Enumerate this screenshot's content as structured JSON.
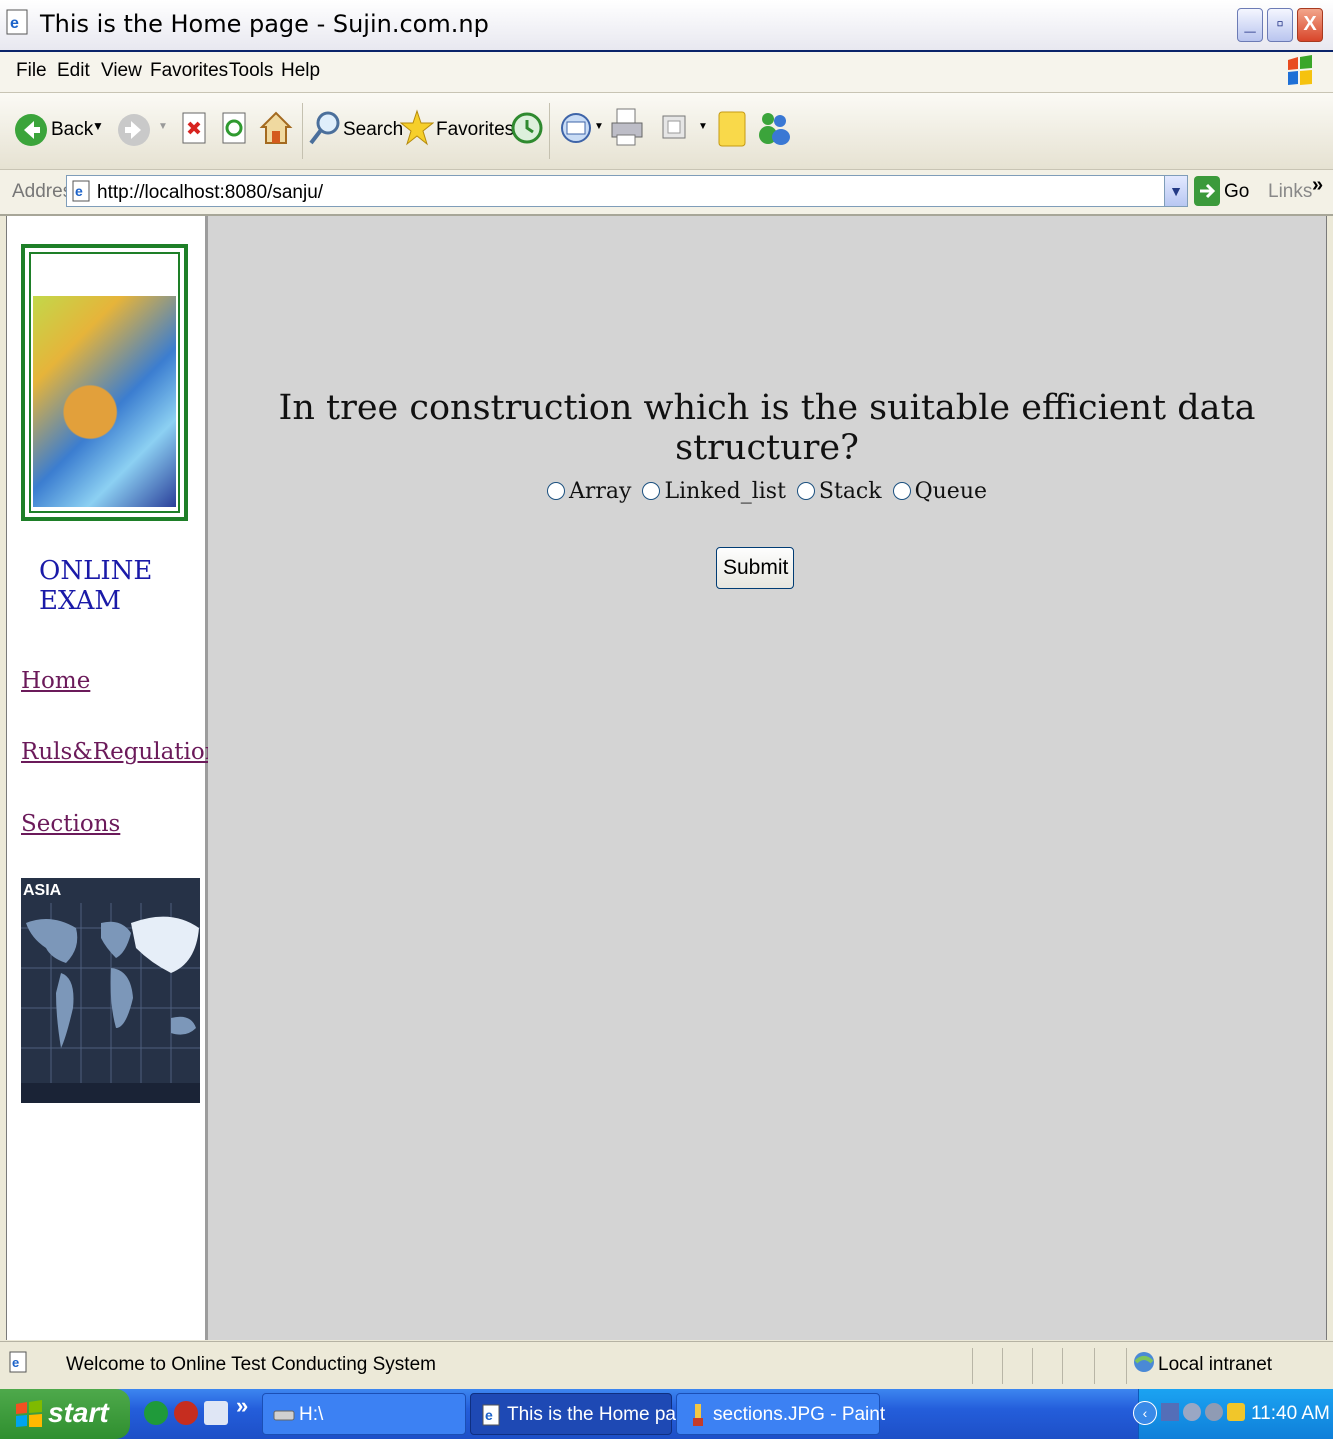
{
  "window": {
    "title": "This is the Home page - Sujin.com.np",
    "minimize": "_",
    "restore": "▫",
    "close": "X"
  },
  "menu": [
    "File",
    "Edit",
    "View",
    "Favorites",
    "Tools",
    "Help"
  ],
  "toolbar": {
    "back": "Back",
    "search": "Search",
    "favorites": "Favorites"
  },
  "address": {
    "label": "Address",
    "url": "http://localhost:8080/sanju/",
    "go": "Go",
    "links": "Links",
    "links_chevron": "»"
  },
  "sidebar": {
    "heading": "ONLINE EXAM",
    "nav": [
      "Home",
      "Ruls&Regulations",
      "Sections"
    ],
    "map_label": "ASIA"
  },
  "quiz": {
    "question": "In tree construction which is the suitable efficient data structure?",
    "options": [
      "Array",
      "Linked_list",
      "Stack",
      "Queue"
    ],
    "submit": "Submit"
  },
  "status": {
    "text": "Welcome to Online Test Conducting System",
    "zone": "Local intranet"
  },
  "taskbar": {
    "start": "start",
    "chevron": "»",
    "tasks": [
      "H:\\",
      "This is the Home pag...",
      "sections.JPG - Paint"
    ],
    "clock": "11:40 AM"
  },
  "colors": {
    "content_bg": "#d4d4d4",
    "nav_link": "#6b1a5a",
    "heading_blue": "#1a1aa8",
    "logo_border": "#1e7f28"
  }
}
